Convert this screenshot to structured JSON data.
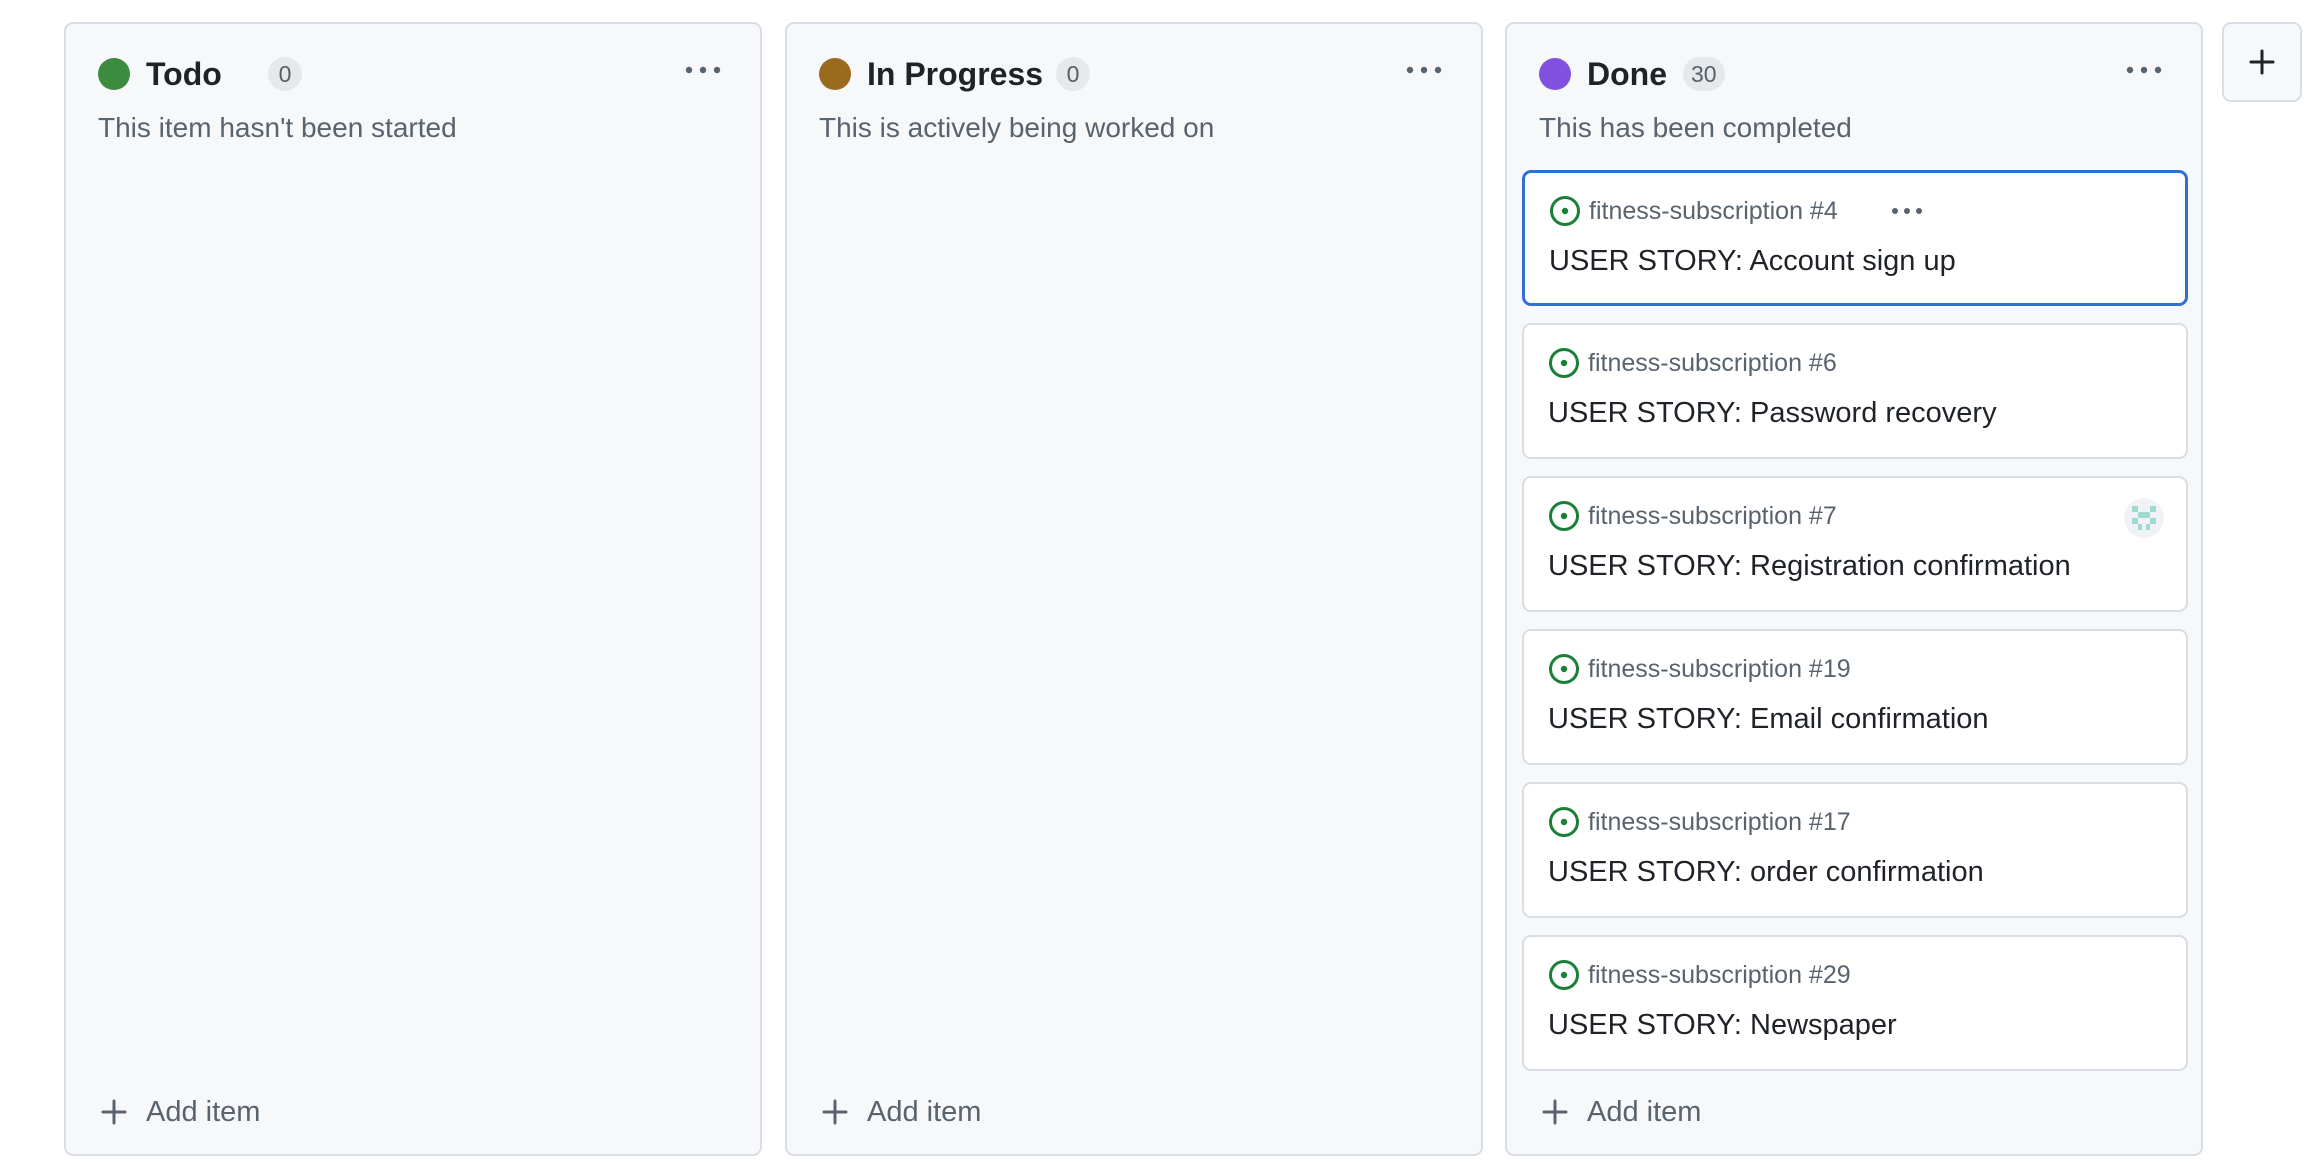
{
  "columns": [
    {
      "title": "Todo",
      "count": "0",
      "description": "This item hasn't been started",
      "dot_color": "#3c8b3f",
      "add_label": "Add item",
      "cards": []
    },
    {
      "title": "In Progress",
      "count": "0",
      "description": "This is actively being worked on",
      "dot_color": "#9a6b1e",
      "add_label": "Add item",
      "cards": []
    },
    {
      "title": "Done",
      "count": "30",
      "description": "This has been completed",
      "dot_color": "#8250df",
      "add_label": "Add item",
      "cards": [
        {
          "repo": "fitness-subscription #4",
          "title": "USER STORY: Account sign up",
          "focused": true
        },
        {
          "repo": "fitness-subscription #6",
          "title": "USER STORY: Password recovery"
        },
        {
          "repo": "fitness-subscription #7",
          "title": "USER STORY: Registration confirmation",
          "assignee_avatar": "avatar-icon"
        },
        {
          "repo": "fitness-subscription #19",
          "title": "USER STORY: Email confirmation"
        },
        {
          "repo": "fitness-subscription #17",
          "title": "USER STORY: order confirmation"
        },
        {
          "repo": "fitness-subscription #29",
          "title": "USER STORY: Newspaper"
        }
      ]
    }
  ],
  "icons": {
    "column_menu": "kebab-horizontal-icon",
    "add_item": "plus-icon",
    "issue_status": "issue-open-icon",
    "add_column": "plus-icon"
  },
  "colors": {
    "issue_open": "#1a7f37",
    "focus_border": "#2f6fd6",
    "muted_text": "#59636e"
  }
}
